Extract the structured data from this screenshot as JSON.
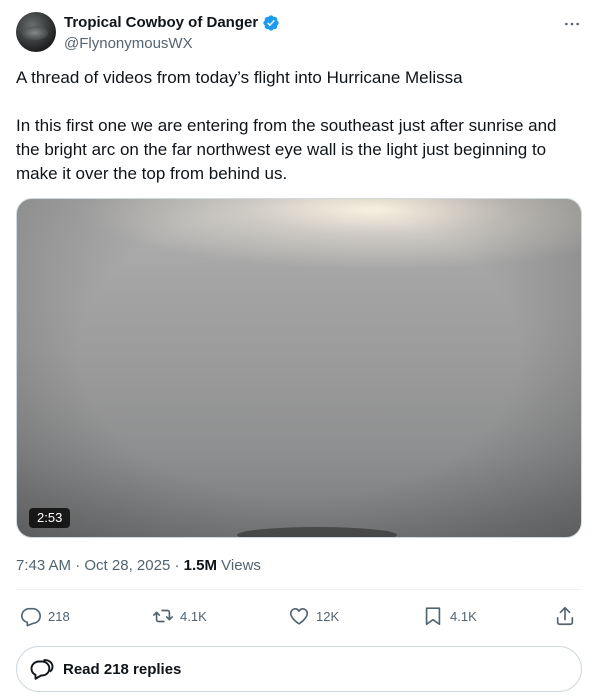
{
  "author": {
    "display_name": "Tropical Cowboy of Danger",
    "handle": "@FlynonymousWX",
    "verified": true
  },
  "tweet": {
    "paragraphs": [
      "A thread of videos from today’s flight into Hurricane Melissa",
      "In this first one we are entering from the southeast just after sunrise and the bright arc on the far northwest eye wall is the light just beginning to make it over the top from behind us."
    ]
  },
  "media": {
    "duration": "2:53"
  },
  "meta": {
    "time": "7:43 AM",
    "date": "Oct 28, 2025",
    "views_count": "1.5M",
    "views_label": "Views"
  },
  "actions": {
    "replies": "218",
    "reposts": "4.1K",
    "likes": "12K",
    "bookmarks": "4.1K"
  },
  "read_replies": {
    "label": "Read 218 replies"
  },
  "colors": {
    "verified_blue": "#1d9bf0",
    "text_primary": "#0f1419",
    "text_secondary": "#536471"
  },
  "icons": [
    "verified-badge-icon",
    "more-icon",
    "reply-icon",
    "repost-icon",
    "like-icon",
    "bookmark-icon",
    "share-icon",
    "chat-bubbles-icon"
  ]
}
